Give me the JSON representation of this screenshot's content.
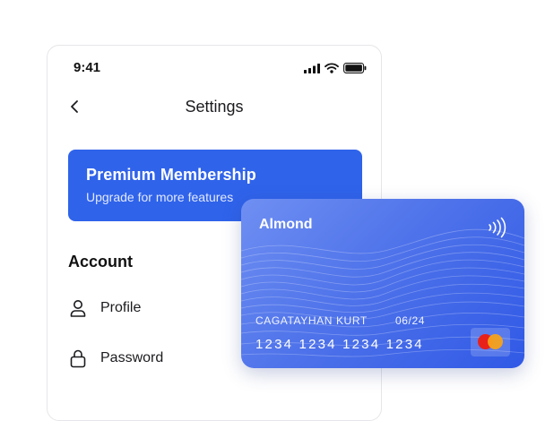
{
  "status_bar": {
    "time": "9:41",
    "icons": [
      "signal-icon",
      "wifi-icon",
      "battery-icon"
    ]
  },
  "header": {
    "title": "Settings",
    "back_icon": "chevron-left-icon"
  },
  "premium": {
    "title": "Premium Membership",
    "subtitle": "Upgrade for more features",
    "color": "#2f63ea"
  },
  "account": {
    "heading": "Account",
    "items": [
      {
        "label": "Profile",
        "icon": "user-icon"
      },
      {
        "label": "Password",
        "icon": "lock-icon"
      }
    ]
  },
  "card": {
    "name": "Almond",
    "holder": "CAGATAYHAN KURT",
    "expiry": "06/24",
    "number": "1234 1234 1234 1234",
    "brand_icon": "mastercard-icon",
    "contactless_icon": "contactless-icon",
    "colors": [
      "#6f8ff2",
      "#3059e6"
    ]
  }
}
